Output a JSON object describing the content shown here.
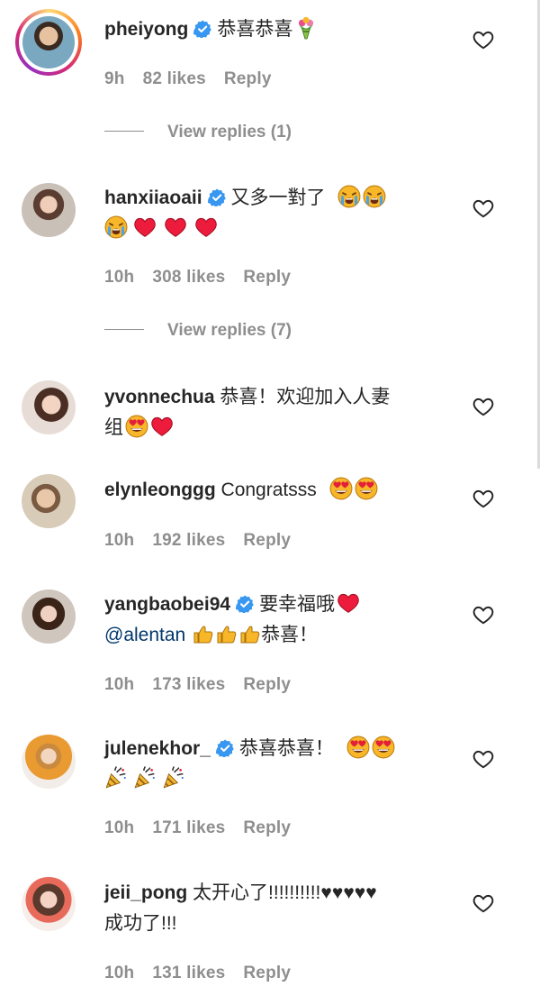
{
  "comments": [
    {
      "username": "pheiyong",
      "verified": true,
      "text": "恭喜恭喜",
      "time": "9h",
      "likes": "82 likes",
      "reply": "Reply",
      "view_replies": "View replies (1)"
    },
    {
      "username": "hanxiiaoaii",
      "verified": true,
      "text": "又多一對了",
      "time": "10h",
      "likes": "308 likes",
      "reply": "Reply",
      "view_replies": "View replies (7)"
    },
    {
      "username": "yvonnechua",
      "verified": false,
      "text": "恭喜！欢迎加入人妻",
      "text2": "组"
    },
    {
      "username": "elynleonggg",
      "verified": false,
      "text": "Congratsss",
      "time": "10h",
      "likes": "192 likes",
      "reply": "Reply"
    },
    {
      "username": "yangbaobei94",
      "verified": true,
      "text": "要幸福哦",
      "mention": "@alentan",
      "text2": "恭喜！",
      "time": "10h",
      "likes": "173 likes",
      "reply": "Reply"
    },
    {
      "username": "julenekhor_",
      "verified": true,
      "text": "恭喜恭喜！",
      "time": "10h",
      "likes": "171 likes",
      "reply": "Reply"
    },
    {
      "username": "jeii_pong",
      "verified": false,
      "text": "太开心了!!!!!!!!!!♥♥♥♥♥",
      "text2": "成功了!!!",
      "time": "10h",
      "likes": "131 likes",
      "reply": "Reply"
    }
  ],
  "icons": {
    "heart": "heart-outline-icon",
    "verified": "verified-badge-icon",
    "emoji_bouquet": "bouquet-emoji",
    "emoji_crying": "loudly-crying-emoji",
    "emoji_red_heart": "red-heart-emoji",
    "emoji_heart_eyes": "heart-eyes-emoji",
    "emoji_thumbs_up": "thumbs-up-emoji",
    "emoji_party_popper": "party-popper-emoji"
  },
  "colors": {
    "text": "#262626",
    "muted": "#8e8e8e",
    "verified": "#3897f0",
    "mention": "#00376b",
    "red_heart": "#ed1c3c"
  }
}
